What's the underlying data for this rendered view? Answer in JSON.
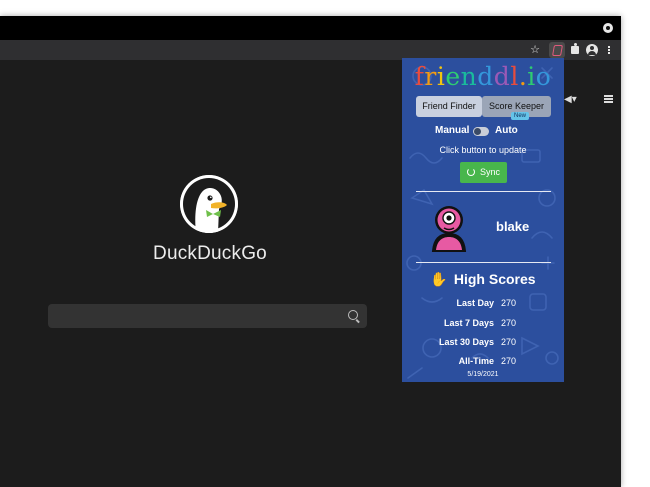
{
  "duckduckgo": {
    "title": "DuckDuckGo",
    "search": {
      "value": "",
      "placeholder": ""
    }
  },
  "popup": {
    "brand": "frienddl.io",
    "brand_colors": [
      "#e84c3d",
      "#f39c12",
      "#f1c40f",
      "#2ecc71",
      "#1abc9c",
      "#3498db",
      "#9b59b6",
      "#e84c3d",
      "#f39c12",
      "#2ecc71",
      "#3498db"
    ],
    "tabs": [
      {
        "label": "Friend Finder"
      },
      {
        "label": "Score Keeper"
      }
    ],
    "new_badge": "New",
    "mode": {
      "manual": "Manual",
      "auto": "Auto"
    },
    "hint": "Click button to update",
    "sync_label": "Sync",
    "username": "blake",
    "high_scores_title": "High Scores",
    "scores": [
      {
        "label": "Last Day",
        "value": "270"
      },
      {
        "label": "Last 7 Days",
        "value": "270"
      },
      {
        "label": "Last 30 Days",
        "value": "270"
      },
      {
        "label": "All-Time",
        "value": "270"
      }
    ],
    "date": "5/19/2021"
  },
  "colors": {
    "browser_bg": "#1c1c1c",
    "popup_bg": "#2c4f9e",
    "sync_green": "#48b64c",
    "badge_blue": "#64c3e8"
  },
  "icons": [
    "star-icon",
    "extension-icon",
    "puzzle-icon",
    "profile-icon",
    "menu-dots-icon",
    "megaphone-icon",
    "hamburger-icon",
    "search-icon",
    "sync-icon",
    "wave-icon",
    "duck-logo"
  ]
}
